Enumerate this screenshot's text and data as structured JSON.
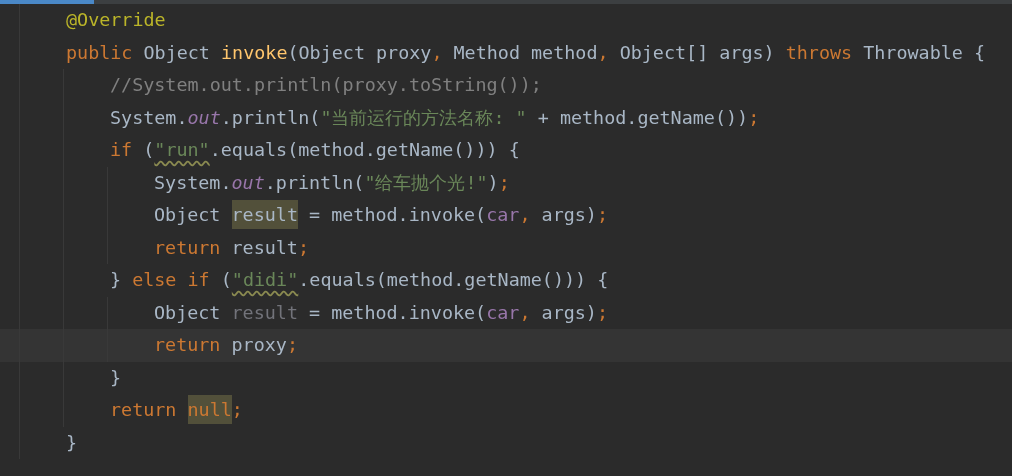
{
  "editor": {
    "tab_strip": {
      "active_tab": {
        "selected": true
      }
    },
    "lines": [
      {
        "current": false,
        "tokens": [
          {
            "kind": "annotation",
            "text": "@Override"
          }
        ]
      },
      {
        "current": false,
        "tokens": [
          {
            "kind": "keyword",
            "text": "public"
          },
          {
            "kind": "plain",
            "text": " Object "
          },
          {
            "kind": "declaration",
            "text": "invoke"
          },
          {
            "kind": "plain",
            "text": "(Object proxy"
          },
          {
            "kind": "keyword",
            "text": ","
          },
          {
            "kind": "plain",
            "text": " Method method"
          },
          {
            "kind": "keyword",
            "text": ","
          },
          {
            "kind": "plain",
            "text": " Object[] args) "
          },
          {
            "kind": "keyword",
            "text": "throws"
          },
          {
            "kind": "plain",
            "text": " Throwable {"
          }
        ],
        "children": [
          {
            "current": false,
            "tokens": [
              {
                "kind": "comment",
                "text": "//System.out.println(proxy.toString());"
              }
            ]
          },
          {
            "current": false,
            "tokens": [
              {
                "kind": "plain",
                "text": "System."
              },
              {
                "kind": "static",
                "text": "out"
              },
              {
                "kind": "plain",
                "text": ".println("
              },
              {
                "kind": "string",
                "text": "\"当前运行的方法名称: \""
              },
              {
                "kind": "plain",
                "text": " + method.getName())"
              },
              {
                "kind": "keyword",
                "text": ";"
              }
            ]
          },
          {
            "current": false,
            "tokens": [
              {
                "kind": "keyword",
                "text": "if"
              },
              {
                "kind": "plain",
                "text": " ("
              },
              {
                "kind": "misspelt",
                "text": "\"run\""
              },
              {
                "kind": "plain",
                "text": ".equals(method.getName())) {"
              }
            ],
            "children": [
              {
                "current": false,
                "tokens": [
                  {
                    "kind": "plain",
                    "text": "System."
                  },
                  {
                    "kind": "static",
                    "text": "out"
                  },
                  {
                    "kind": "plain",
                    "text": ".println("
                  },
                  {
                    "kind": "string",
                    "text": "\"给车抛个光!\""
                  },
                  {
                    "kind": "plain",
                    "text": ")"
                  },
                  {
                    "kind": "keyword",
                    "text": ";"
                  }
                ]
              },
              {
                "current": false,
                "tokens": [
                  {
                    "kind": "plain",
                    "text": "Object "
                  },
                  {
                    "kind": "occurrence",
                    "text": "result"
                  },
                  {
                    "kind": "plain",
                    "text": " = method.invoke("
                  },
                  {
                    "kind": "field",
                    "text": "car"
                  },
                  {
                    "kind": "keyword",
                    "text": ","
                  },
                  {
                    "kind": "plain",
                    "text": " args)"
                  },
                  {
                    "kind": "keyword",
                    "text": ";"
                  }
                ]
              },
              {
                "current": false,
                "tokens": [
                  {
                    "kind": "keyword",
                    "text": "return"
                  },
                  {
                    "kind": "plain",
                    "text": " result"
                  },
                  {
                    "kind": "keyword",
                    "text": ";"
                  }
                ]
              }
            ]
          },
          {
            "current": false,
            "tokens": [
              {
                "kind": "plain",
                "text": "} "
              },
              {
                "kind": "keyword",
                "text": "else if"
              },
              {
                "kind": "plain",
                "text": " ("
              },
              {
                "kind": "misspelt",
                "text": "\"didi\""
              },
              {
                "kind": "plain",
                "text": ".equals(method.getName())) {"
              }
            ],
            "children": [
              {
                "current": false,
                "tokens": [
                  {
                    "kind": "plain",
                    "text": "Object "
                  },
                  {
                    "kind": "unused",
                    "text": "result"
                  },
                  {
                    "kind": "plain",
                    "text": " = method.invoke("
                  },
                  {
                    "kind": "field",
                    "text": "car"
                  },
                  {
                    "kind": "keyword",
                    "text": ","
                  },
                  {
                    "kind": "plain",
                    "text": " args)"
                  },
                  {
                    "kind": "keyword",
                    "text": ";"
                  }
                ]
              },
              {
                "current": true,
                "tokens": [
                  {
                    "kind": "keyword",
                    "text": "return"
                  },
                  {
                    "kind": "plain",
                    "text": " proxy"
                  },
                  {
                    "kind": "keyword",
                    "text": ";"
                  }
                ]
              }
            ]
          },
          {
            "current": false,
            "tokens": [
              {
                "kind": "plain",
                "text": "}"
              }
            ]
          },
          {
            "current": false,
            "tokens": [
              {
                "kind": "keyword",
                "text": "return "
              },
              {
                "kind": "constant",
                "text": "null"
              },
              {
                "kind": "keyword",
                "text": ";"
              }
            ]
          }
        ]
      },
      {
        "current": false,
        "tokens": [
          {
            "kind": "plain",
            "text": "}"
          }
        ]
      }
    ]
  }
}
